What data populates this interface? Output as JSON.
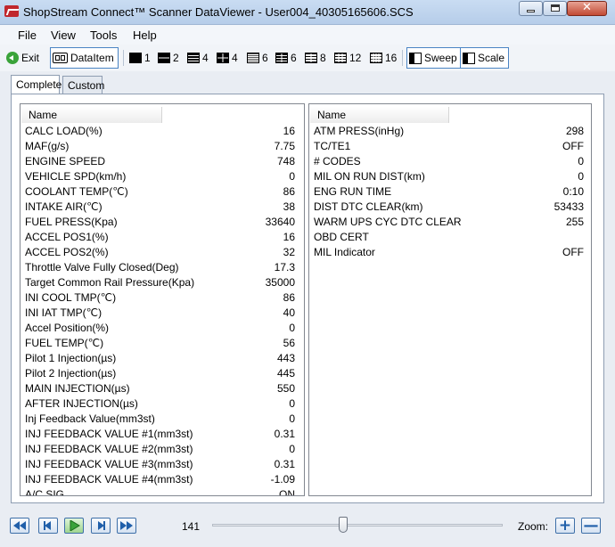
{
  "window": {
    "title": "ShopStream Connect™ Scanner DataViewer - User004_40305165606.SCS",
    "minimize": "—",
    "maximize": "□",
    "close": "✕"
  },
  "menu": [
    {
      "label": "File"
    },
    {
      "label": "View"
    },
    {
      "label": "Tools"
    },
    {
      "label": "Help"
    }
  ],
  "toolbar": {
    "exit": "Exit",
    "dataitem": "DataItem",
    "layouts": [
      "1",
      "2",
      "4",
      "4",
      "6",
      "6",
      "8",
      "12",
      "16"
    ],
    "sweep": "Sweep",
    "scale": "Scale"
  },
  "tabs": [
    {
      "label": "Complete",
      "active": true
    },
    {
      "label": "Custom",
      "active": false
    }
  ],
  "left_pane": {
    "header": "Name",
    "rows": [
      {
        "name": "CALC LOAD(%)",
        "value": "16"
      },
      {
        "name": "MAF(g/s)",
        "value": "7.75"
      },
      {
        "name": "ENGINE SPEED",
        "value": "748"
      },
      {
        "name": "VEHICLE SPD(km/h)",
        "value": "0"
      },
      {
        "name": "COOLANT TEMP(℃)",
        "value": "86"
      },
      {
        "name": "INTAKE AIR(℃)",
        "value": "38"
      },
      {
        "name": "FUEL PRESS(Kpa)",
        "value": "33640"
      },
      {
        "name": "ACCEL POS1(%)",
        "value": "16"
      },
      {
        "name": "ACCEL POS2(%)",
        "value": "32"
      },
      {
        "name": "Throttle Valve Fully Closed(Deg)",
        "value": "17.3"
      },
      {
        "name": "Target Common Rail Pressure(Kpa)",
        "value": "35000"
      },
      {
        "name": "INI COOL TMP(℃)",
        "value": "86"
      },
      {
        "name": "INI IAT TMP(℃)",
        "value": "40"
      },
      {
        "name": "Accel Position(%)",
        "value": "0"
      },
      {
        "name": "FUEL TEMP(℃)",
        "value": "56"
      },
      {
        "name": "Pilot 1 Injection(µs)",
        "value": "443"
      },
      {
        "name": "Pilot 2 Injection(µs)",
        "value": "445"
      },
      {
        "name": "MAIN INJECTION(µs)",
        "value": "550"
      },
      {
        "name": "AFTER INJECTION(µs)",
        "value": "0"
      },
      {
        "name": "Inj Feedback Value(mm3st)",
        "value": "0"
      },
      {
        "name": "INJ FEEDBACK VALUE #1(mm3st)",
        "value": "0.31"
      },
      {
        "name": "INJ FEEDBACK VALUE #2(mm3st)",
        "value": "0"
      },
      {
        "name": "INJ FEEDBACK VALUE #3(mm3st)",
        "value": "0.31"
      },
      {
        "name": "INJ FEEDBACK VALUE #4(mm3st)",
        "value": "-1.09"
      },
      {
        "name": "A/C SIG",
        "value": "ON"
      }
    ]
  },
  "right_pane": {
    "header": "Name",
    "rows": [
      {
        "name": "ATM PRESS(inHg)",
        "value": "298"
      },
      {
        "name": "TC/TE1",
        "value": "OFF"
      },
      {
        "name": "# CODES",
        "value": "0"
      },
      {
        "name": "MIL ON RUN DIST(km)",
        "value": "0"
      },
      {
        "name": "ENG RUN TIME",
        "value": "0:10"
      },
      {
        "name": "DIST DTC CLEAR(km)",
        "value": "53433"
      },
      {
        "name": "WARM UPS CYC DTC CLEAR",
        "value": "255"
      },
      {
        "name": "OBD CERT",
        "value": ""
      },
      {
        "name": "MIL Indicator",
        "value": "OFF"
      }
    ]
  },
  "playback": {
    "frame": "141",
    "zoom_label": "Zoom:",
    "zoom_in": "+",
    "zoom_out": "—",
    "position_fraction": 0.45,
    "colors": {
      "accent": "#1f5faa",
      "play": "#3aa33a"
    }
  }
}
